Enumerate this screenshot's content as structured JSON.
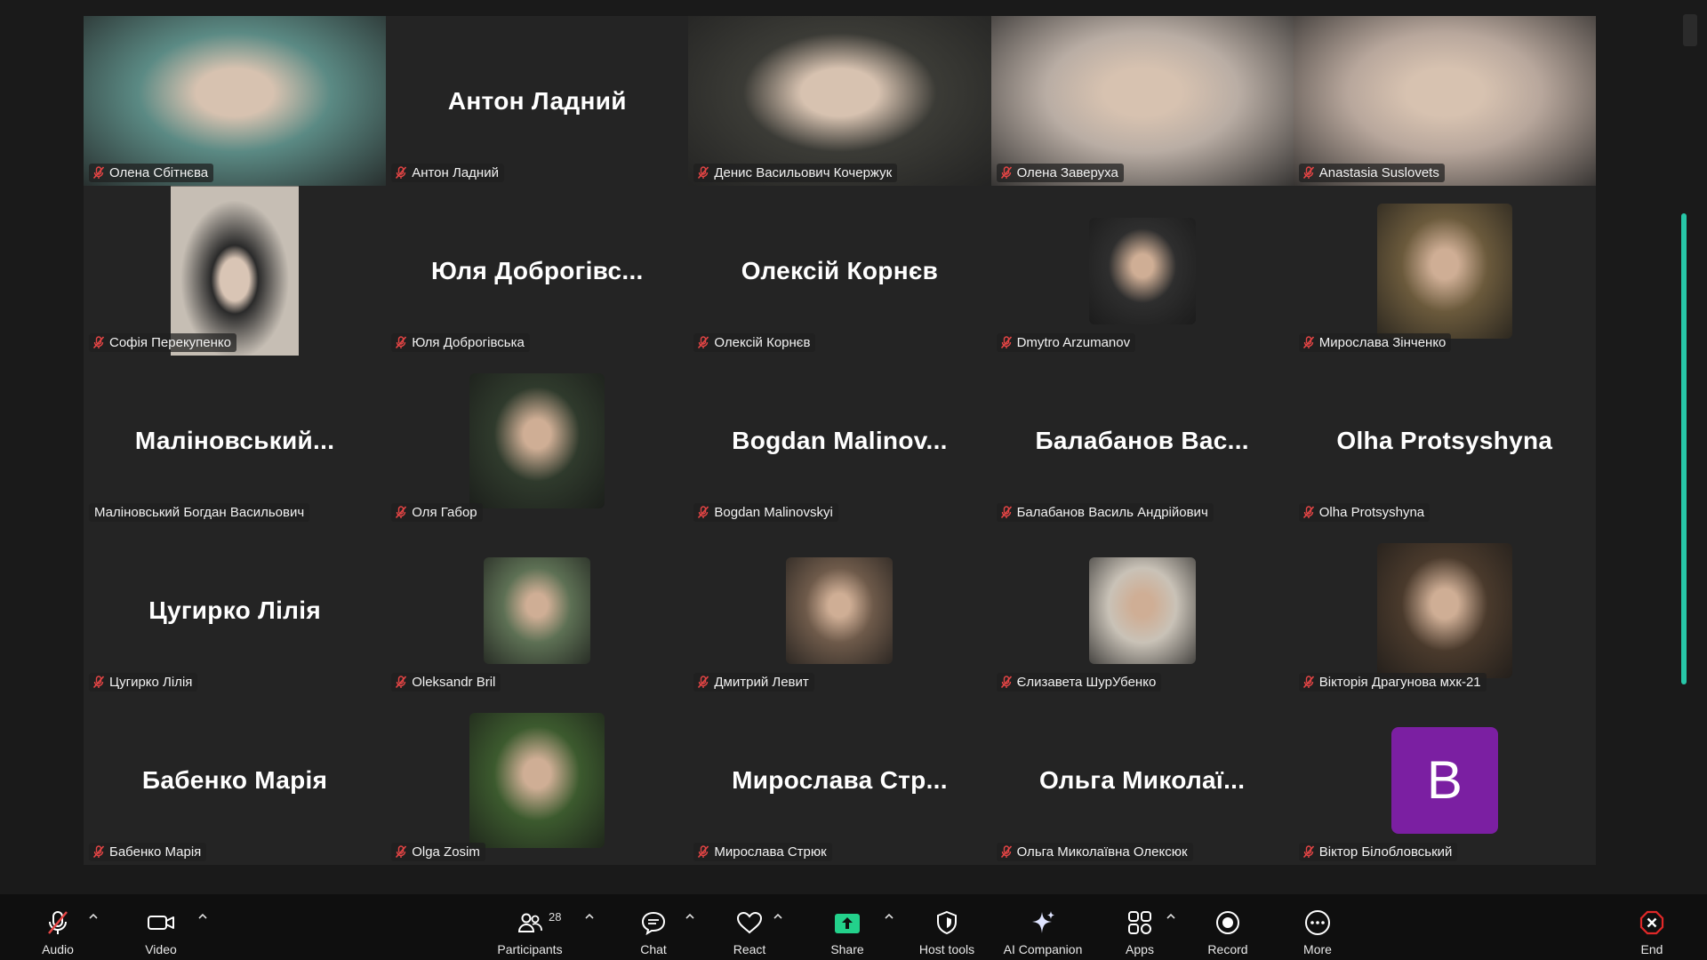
{
  "participants": [
    {
      "name": "Олена Сбітнєва",
      "display": "",
      "mode": "video",
      "muted": true,
      "bg": "#5b8a84"
    },
    {
      "name": "Антон Ладний",
      "display": "Антон Ладний",
      "mode": "name",
      "muted": true
    },
    {
      "name": "Денис Васильович Кочержук",
      "display": "",
      "mode": "video",
      "muted": true,
      "bg": "#3b3b36"
    },
    {
      "name": "Олена Заверуха",
      "display": "",
      "mode": "video",
      "muted": true,
      "bg": "#b9ada4"
    },
    {
      "name": "Anastasia Suslovets",
      "display": "",
      "mode": "video",
      "muted": true,
      "bg": "#b8a79c"
    },
    {
      "name": "Софія Перекупенко",
      "display": "",
      "mode": "video-portrait",
      "muted": true,
      "bg": "#c6beb4"
    },
    {
      "name": "Юля Доброгівська",
      "display": "Юля Доброгівс...",
      "mode": "name",
      "muted": true
    },
    {
      "name": "Олексій Корнєв",
      "display": "Олексій Корнєв",
      "mode": "name",
      "muted": true
    },
    {
      "name": "Dmytro Arzumanov",
      "display": "",
      "mode": "thumb",
      "muted": true,
      "bg": "#2e2e2e"
    },
    {
      "name": "Мирослава Зінченко",
      "display": "",
      "mode": "thumb-large",
      "muted": true,
      "bg": "#6b5a3c"
    },
    {
      "name": "Маліновський Богдан Васильович",
      "display": "Маліновський...",
      "mode": "name",
      "muted": false
    },
    {
      "name": "Оля Габор",
      "display": "",
      "mode": "thumb-large",
      "muted": true,
      "bg": "#2f3a2c"
    },
    {
      "name": "Bogdan Malinovskyi",
      "display": "Bogdan Malinov...",
      "mode": "name",
      "muted": true
    },
    {
      "name": "Балабанов Василь Андрійович",
      "display": "Балабанов Вас...",
      "mode": "name",
      "muted": true
    },
    {
      "name": "Olha Protsyshyna",
      "display": "Olha Protsyshyna",
      "mode": "name",
      "muted": true
    },
    {
      "name": "Цугирко Лілія",
      "display": "Цугирко Лілія",
      "mode": "name",
      "muted": true
    },
    {
      "name": "Oleksandr Bril",
      "display": "",
      "mode": "thumb",
      "muted": true,
      "bg": "#5d7054"
    },
    {
      "name": "Дмитрий Левит",
      "display": "",
      "mode": "thumb",
      "muted": true,
      "bg": "#6e5a4a"
    },
    {
      "name": "Єлизавета ШурУбенко",
      "display": "",
      "mode": "thumb",
      "muted": true,
      "bg": "#c9c2b7"
    },
    {
      "name": "Вікторія Драгунова мхк-21",
      "display": "",
      "mode": "thumb-large",
      "muted": true,
      "bg": "#4a3a2c"
    },
    {
      "name": "Бабенко Марія",
      "display": "Бабенко Марія",
      "mode": "name",
      "muted": true
    },
    {
      "name": "Olga Zosim",
      "display": "",
      "mode": "thumb-large",
      "muted": true,
      "bg": "#3c5a2e"
    },
    {
      "name": "Мирослава Стрюк",
      "display": "Мирослава Стр...",
      "mode": "name",
      "muted": true
    },
    {
      "name": "Ольга Миколаївна Олексюк",
      "display": "Ольга Миколаї...",
      "mode": "name",
      "muted": true
    },
    {
      "name": "Віктор Білобловський",
      "display": "",
      "mode": "letter",
      "letter": "B",
      "muted": true,
      "bg": "#7b1fa2"
    }
  ],
  "toolbar": {
    "audio": "Audio",
    "video": "Video",
    "participants": "Participants",
    "participants_count": "28",
    "chat": "Chat",
    "react": "React",
    "share": "Share",
    "host_tools": "Host tools",
    "ai_companion": "AI Companion",
    "apps": "Apps",
    "record": "Record",
    "more": "More",
    "end": "End"
  },
  "colors": {
    "accent_green": "#23d18b",
    "mute_red": "#e64545",
    "end_red": "#e02828",
    "scroll_teal": "#27c7a8"
  }
}
